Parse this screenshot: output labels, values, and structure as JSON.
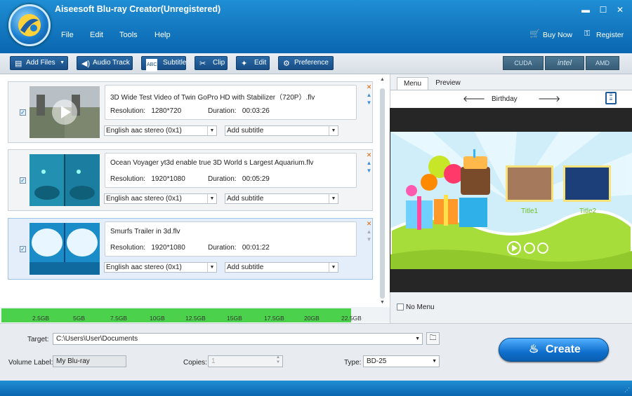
{
  "app": {
    "title": "Aiseesoft Blu-ray Creator(Unregistered)"
  },
  "menu": {
    "items": [
      "File",
      "Edit",
      "Tools",
      "Help"
    ]
  },
  "top_right": {
    "buy_now": "Buy Now",
    "register": "Register"
  },
  "window_buttons": {
    "minimize": "▬",
    "maximize": "☐",
    "close": "✕"
  },
  "toolbar": {
    "add_files": "Add Files",
    "audio_track": "Audio Track",
    "subtitle": "Subtitle",
    "clip": "Clip",
    "edit": "Edit",
    "preference": "Preference",
    "hw": [
      "CUDA",
      "intel",
      "AMD"
    ]
  },
  "files": [
    {
      "name": "3D Wide Test Video of Twin GoPro HD with Stabilizer（720P）.flv",
      "resolution_label": "Resolution:",
      "resolution": "1280*720",
      "duration_label": "Duration:",
      "duration": "00:03:26",
      "audio": "English aac stereo (0x1)",
      "subtitle": "Add subtitle",
      "checked": true
    },
    {
      "name": "Ocean Voyager yt3d enable true 3D World s Largest Aquarium.flv",
      "resolution_label": "Resolution:",
      "resolution": "1920*1080",
      "duration_label": "Duration:",
      "duration": "00:05:29",
      "audio": "English aac stereo (0x1)",
      "subtitle": "Add subtitle",
      "checked": true
    },
    {
      "name": "Smurfs Trailer in 3d.flv",
      "resolution_label": "Resolution:",
      "resolution": "1920*1080",
      "duration_label": "Duration:",
      "duration": "00:01:22",
      "audio": "English aac stereo (0x1)",
      "subtitle": "Add subtitle",
      "checked": true
    }
  ],
  "capacity": {
    "ticks": [
      "2.5GB",
      "5GB",
      "7.5GB",
      "10GB",
      "12.5GB",
      "15GB",
      "17.5GB",
      "20GB",
      "22.5GB"
    ],
    "used_fraction": 0.9
  },
  "right_panel": {
    "tabs": [
      "Menu",
      "Preview"
    ],
    "active_tab": "Menu",
    "template_name": "Birthday",
    "thumb_titles": [
      "Title1",
      "Title2"
    ],
    "no_menu_label": "No Menu"
  },
  "bottom": {
    "target_label": "Target:",
    "target_value": "C:\\Users\\User\\Documents",
    "volume_label": "Volume Label:",
    "volume_value": "My Blu-ray",
    "copies_label": "Copies:",
    "copies_value": "1",
    "type_label": "Type:",
    "type_value": "BD-25",
    "create_label": "Create"
  },
  "colors": {
    "brand_blue": "#0a66b0",
    "capacity_green": "#4cd14c",
    "create_blue": "#1a7fd8"
  }
}
